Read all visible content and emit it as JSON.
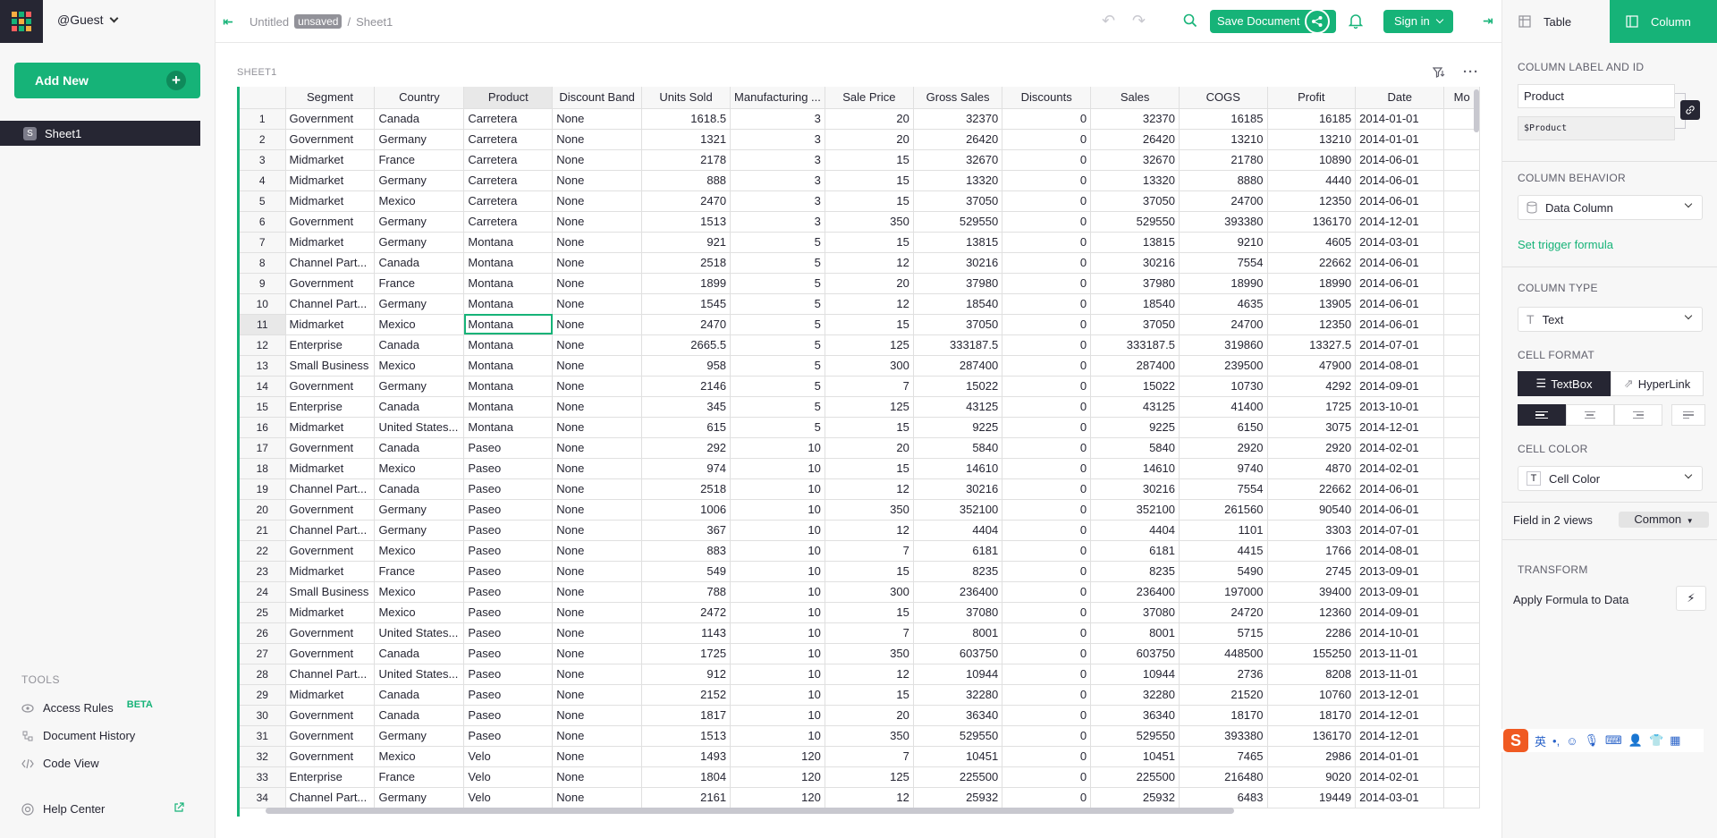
{
  "user": {
    "name": "@Guest"
  },
  "left_panel": {
    "add_new_label": "Add New",
    "pages": [
      {
        "icon": "S",
        "label": "Sheet1"
      }
    ],
    "tools_title": "TOOLS",
    "tools": [
      {
        "label": "Access Rules",
        "badge": "BETA",
        "icon": "eye-icon"
      },
      {
        "label": "Document History",
        "icon": "history-icon"
      },
      {
        "label": "Code View",
        "icon": "code-icon"
      }
    ],
    "help_label": "Help Center"
  },
  "topbar": {
    "doc_name": "Untitled",
    "unsaved_badge": "unsaved",
    "separator": "/",
    "page_name": "Sheet1",
    "save_label": "Save Document",
    "signin_label": "Sign in"
  },
  "sheet": {
    "title": "SHEET1",
    "columns": [
      "Segment",
      "Country",
      "Product",
      "Discount Band",
      "Units Sold",
      "Manufacturing ...",
      "Sale Price",
      "Gross Sales",
      "Discounts",
      "Sales",
      "COGS",
      "Profit",
      "Date",
      "Mo"
    ],
    "rows": [
      [
        "1",
        "Government",
        "Canada",
        "Carretera",
        "None",
        "1618.5",
        "3",
        "20",
        "32370",
        "0",
        "32370",
        "16185",
        "16185",
        "2014-01-01"
      ],
      [
        "2",
        "Government",
        "Germany",
        "Carretera",
        "None",
        "1321",
        "3",
        "20",
        "26420",
        "0",
        "26420",
        "13210",
        "13210",
        "2014-01-01"
      ],
      [
        "3",
        "Midmarket",
        "France",
        "Carretera",
        "None",
        "2178",
        "3",
        "15",
        "32670",
        "0",
        "32670",
        "21780",
        "10890",
        "2014-06-01"
      ],
      [
        "4",
        "Midmarket",
        "Germany",
        "Carretera",
        "None",
        "888",
        "3",
        "15",
        "13320",
        "0",
        "13320",
        "8880",
        "4440",
        "2014-06-01"
      ],
      [
        "5",
        "Midmarket",
        "Mexico",
        "Carretera",
        "None",
        "2470",
        "3",
        "15",
        "37050",
        "0",
        "37050",
        "24700",
        "12350",
        "2014-06-01"
      ],
      [
        "6",
        "Government",
        "Germany",
        "Carretera",
        "None",
        "1513",
        "3",
        "350",
        "529550",
        "0",
        "529550",
        "393380",
        "136170",
        "2014-12-01"
      ],
      [
        "7",
        "Midmarket",
        "Germany",
        "Montana",
        "None",
        "921",
        "5",
        "15",
        "13815",
        "0",
        "13815",
        "9210",
        "4605",
        "2014-03-01"
      ],
      [
        "8",
        "Channel Part...",
        "Canada",
        "Montana",
        "None",
        "2518",
        "5",
        "12",
        "30216",
        "0",
        "30216",
        "7554",
        "22662",
        "2014-06-01"
      ],
      [
        "9",
        "Government",
        "France",
        "Montana",
        "None",
        "1899",
        "5",
        "20",
        "37980",
        "0",
        "37980",
        "18990",
        "18990",
        "2014-06-01"
      ],
      [
        "10",
        "Channel Part...",
        "Germany",
        "Montana",
        "None",
        "1545",
        "5",
        "12",
        "18540",
        "0",
        "18540",
        "4635",
        "13905",
        "2014-06-01"
      ],
      [
        "11",
        "Midmarket",
        "Mexico",
        "Montana",
        "None",
        "2470",
        "5",
        "15",
        "37050",
        "0",
        "37050",
        "24700",
        "12350",
        "2014-06-01"
      ],
      [
        "12",
        "Enterprise",
        "Canada",
        "Montana",
        "None",
        "2665.5",
        "5",
        "125",
        "333187.5",
        "0",
        "333187.5",
        "319860",
        "13327.5",
        "2014-07-01"
      ],
      [
        "13",
        "Small Business",
        "Mexico",
        "Montana",
        "None",
        "958",
        "5",
        "300",
        "287400",
        "0",
        "287400",
        "239500",
        "47900",
        "2014-08-01"
      ],
      [
        "14",
        "Government",
        "Germany",
        "Montana",
        "None",
        "2146",
        "5",
        "7",
        "15022",
        "0",
        "15022",
        "10730",
        "4292",
        "2014-09-01"
      ],
      [
        "15",
        "Enterprise",
        "Canada",
        "Montana",
        "None",
        "345",
        "5",
        "125",
        "43125",
        "0",
        "43125",
        "41400",
        "1725",
        "2013-10-01"
      ],
      [
        "16",
        "Midmarket",
        "United States...",
        "Montana",
        "None",
        "615",
        "5",
        "15",
        "9225",
        "0",
        "9225",
        "6150",
        "3075",
        "2014-12-01"
      ],
      [
        "17",
        "Government",
        "Canada",
        "Paseo",
        "None",
        "292",
        "10",
        "20",
        "5840",
        "0",
        "5840",
        "2920",
        "2920",
        "2014-02-01"
      ],
      [
        "18",
        "Midmarket",
        "Mexico",
        "Paseo",
        "None",
        "974",
        "10",
        "15",
        "14610",
        "0",
        "14610",
        "9740",
        "4870",
        "2014-02-01"
      ],
      [
        "19",
        "Channel Part...",
        "Canada",
        "Paseo",
        "None",
        "2518",
        "10",
        "12",
        "30216",
        "0",
        "30216",
        "7554",
        "22662",
        "2014-06-01"
      ],
      [
        "20",
        "Government",
        "Germany",
        "Paseo",
        "None",
        "1006",
        "10",
        "350",
        "352100",
        "0",
        "352100",
        "261560",
        "90540",
        "2014-06-01"
      ],
      [
        "21",
        "Channel Part...",
        "Germany",
        "Paseo",
        "None",
        "367",
        "10",
        "12",
        "4404",
        "0",
        "4404",
        "1101",
        "3303",
        "2014-07-01"
      ],
      [
        "22",
        "Government",
        "Mexico",
        "Paseo",
        "None",
        "883",
        "10",
        "7",
        "6181",
        "0",
        "6181",
        "4415",
        "1766",
        "2014-08-01"
      ],
      [
        "23",
        "Midmarket",
        "France",
        "Paseo",
        "None",
        "549",
        "10",
        "15",
        "8235",
        "0",
        "8235",
        "5490",
        "2745",
        "2013-09-01"
      ],
      [
        "24",
        "Small Business",
        "Mexico",
        "Paseo",
        "None",
        "788",
        "10",
        "300",
        "236400",
        "0",
        "236400",
        "197000",
        "39400",
        "2013-09-01"
      ],
      [
        "25",
        "Midmarket",
        "Mexico",
        "Paseo",
        "None",
        "2472",
        "10",
        "15",
        "37080",
        "0",
        "37080",
        "24720",
        "12360",
        "2014-09-01"
      ],
      [
        "26",
        "Government",
        "United States...",
        "Paseo",
        "None",
        "1143",
        "10",
        "7",
        "8001",
        "0",
        "8001",
        "5715",
        "2286",
        "2014-10-01"
      ],
      [
        "27",
        "Government",
        "Canada",
        "Paseo",
        "None",
        "1725",
        "10",
        "350",
        "603750",
        "0",
        "603750",
        "448500",
        "155250",
        "2013-11-01"
      ],
      [
        "28",
        "Channel Part...",
        "United States...",
        "Paseo",
        "None",
        "912",
        "10",
        "12",
        "10944",
        "0",
        "10944",
        "2736",
        "8208",
        "2013-11-01"
      ],
      [
        "29",
        "Midmarket",
        "Canada",
        "Paseo",
        "None",
        "2152",
        "10",
        "15",
        "32280",
        "0",
        "32280",
        "21520",
        "10760",
        "2013-12-01"
      ],
      [
        "30",
        "Government",
        "Canada",
        "Paseo",
        "None",
        "1817",
        "10",
        "20",
        "36340",
        "0",
        "36340",
        "18170",
        "18170",
        "2014-12-01"
      ],
      [
        "31",
        "Government",
        "Germany",
        "Paseo",
        "None",
        "1513",
        "10",
        "350",
        "529550",
        "0",
        "529550",
        "393380",
        "136170",
        "2014-12-01"
      ],
      [
        "32",
        "Government",
        "Mexico",
        "Velo",
        "None",
        "1493",
        "120",
        "7",
        "10451",
        "0",
        "10451",
        "7465",
        "2986",
        "2014-01-01"
      ],
      [
        "33",
        "Enterprise",
        "France",
        "Velo",
        "None",
        "1804",
        "120",
        "125",
        "225500",
        "0",
        "225500",
        "216480",
        "9020",
        "2014-02-01"
      ],
      [
        "34",
        "Channel Part...",
        "Germany",
        "Velo",
        "None",
        "2161",
        "120",
        "12",
        "25932",
        "0",
        "25932",
        "6483",
        "19449",
        "2014-03-01"
      ]
    ],
    "selected_row": 11,
    "selected_column": "Product"
  },
  "right_panel": {
    "tab_table": "Table",
    "tab_column": "Column",
    "column_label_title": "COLUMN LABEL AND ID",
    "column_label": "Product",
    "column_id": "$Product",
    "column_behavior_title": "COLUMN BEHAVIOR",
    "column_behavior": "Data Column",
    "trigger_formula_link": "Set trigger formula",
    "column_type_title": "COLUMN TYPE",
    "column_type": "Text",
    "cell_format_title": "CELL FORMAT",
    "format_textbox": "TextBox",
    "format_hyperlink": "HyperLink",
    "cell_color_title": "CELL COLOR",
    "cell_color": "Cell Color",
    "field_views": "Field in 2 views",
    "common_label": "Common",
    "transform_title": "TRANSFORM",
    "apply_formula": "Apply Formula to Data"
  },
  "ime": {
    "lang": "英"
  },
  "colors": {
    "accent": "#16b378",
    "dark": "#262633",
    "muted": "#929299"
  }
}
